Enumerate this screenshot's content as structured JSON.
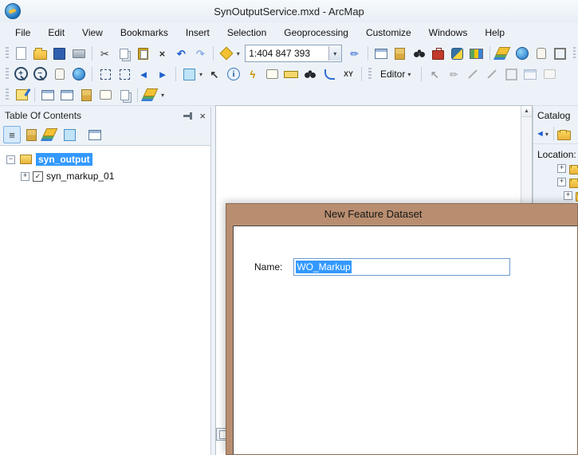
{
  "window": {
    "title": "SynOutputService.mxd - ArcMap"
  },
  "menubar": {
    "items": [
      "File",
      "Edit",
      "View",
      "Bookmarks",
      "Insert",
      "Selection",
      "Geoprocessing",
      "Customize",
      "Windows",
      "Help"
    ]
  },
  "standard_toolbar": {
    "scale_value": "1:404 847 393"
  },
  "tools_toolbar": {
    "editor_label": "Editor"
  },
  "toc": {
    "title": "Table Of Contents",
    "items": [
      {
        "label": "syn_output",
        "selected": true,
        "expanded": true
      },
      {
        "label": "syn_markup_01",
        "checked": true,
        "expanded": false
      }
    ]
  },
  "catalog": {
    "title": "Catalog",
    "location_label": "Location:"
  },
  "dialog": {
    "title": "New Feature Dataset",
    "name_label": "Name:",
    "name_value": "WO_Markup"
  },
  "icons": {
    "cut": "✂",
    "delete": "×",
    "undo": "↶",
    "redo": "↷",
    "dropdown": "▾",
    "back": "◄",
    "forward": "►",
    "zoom_in": "+",
    "zoom_out": "−",
    "select_arrow": "↖",
    "xy": "XY",
    "pencil": "✏",
    "lightning": "ϟ",
    "scroll_up": "▲",
    "close": "×",
    "list": "≡",
    "expand": "+",
    "collapse": "−",
    "check": "✓",
    "identify": "i"
  },
  "colors": {
    "selection_blue": "#3399ff",
    "dialog_title_bg": "#b98e70",
    "toolbar_bg": "#edf2f8"
  }
}
